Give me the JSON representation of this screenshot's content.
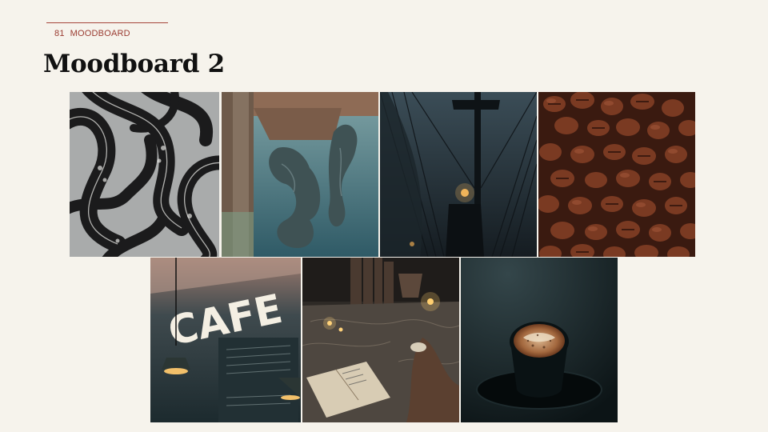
{
  "slide": {
    "section_number": "81",
    "section_label": "MOODBOARD",
    "title": "Moodboard 2"
  },
  "cafe_sign": "CAFE",
  "colors": {
    "background": "#f6f3ec",
    "accent": "#a5443a",
    "title": "#111111"
  }
}
